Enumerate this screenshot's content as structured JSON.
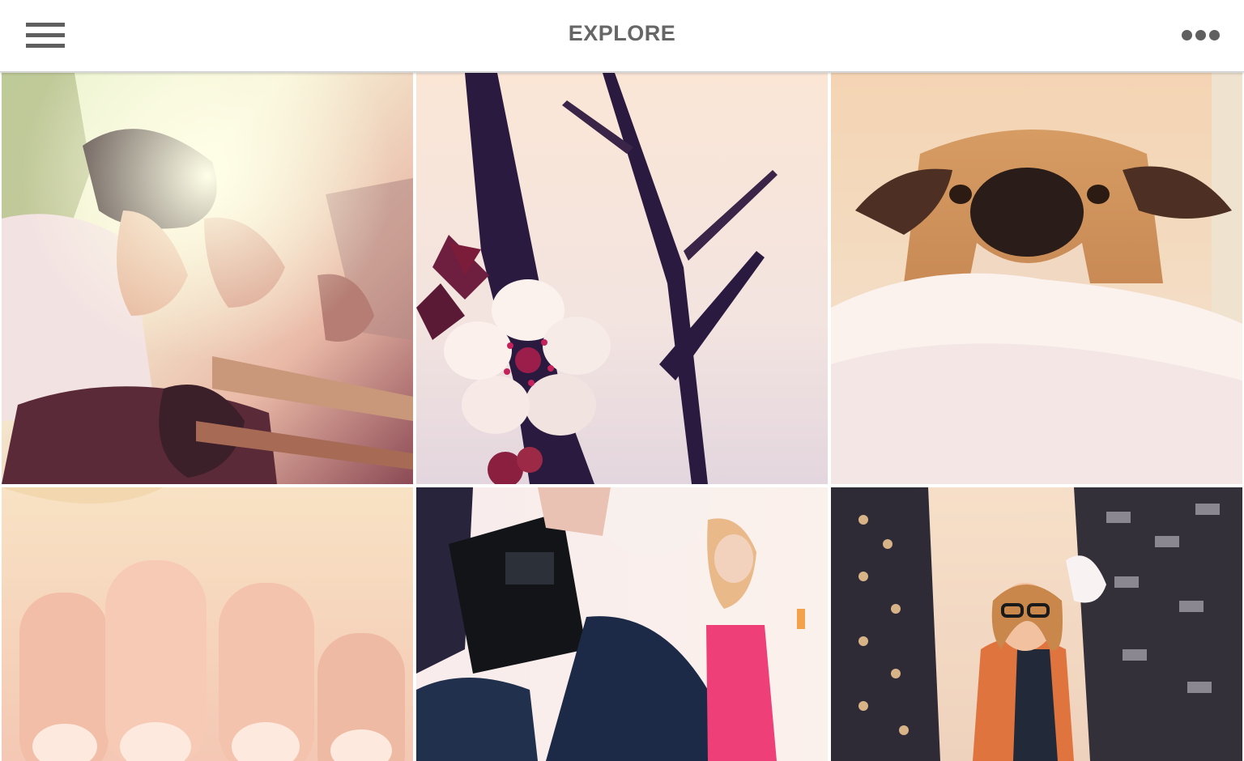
{
  "header": {
    "title": "EXPLORE",
    "menu_icon": "hamburger-menu-icon",
    "more_icon": "more-options-icon"
  },
  "photos": [
    {
      "subject": "friends-playing-guitars"
    },
    {
      "subject": "cherry-blossom"
    },
    {
      "subject": "dog-peeking-over-bed"
    },
    {
      "subject": "fingernails-closeup"
    },
    {
      "subject": "photographer-shooting-model"
    },
    {
      "subject": "woman-in-glasses-hardware-aisle"
    }
  ],
  "colors": {
    "header_bg": "#ffffff",
    "header_text": "#666666",
    "icon": "#5f5f5f",
    "page_bg": "#ffffff"
  }
}
